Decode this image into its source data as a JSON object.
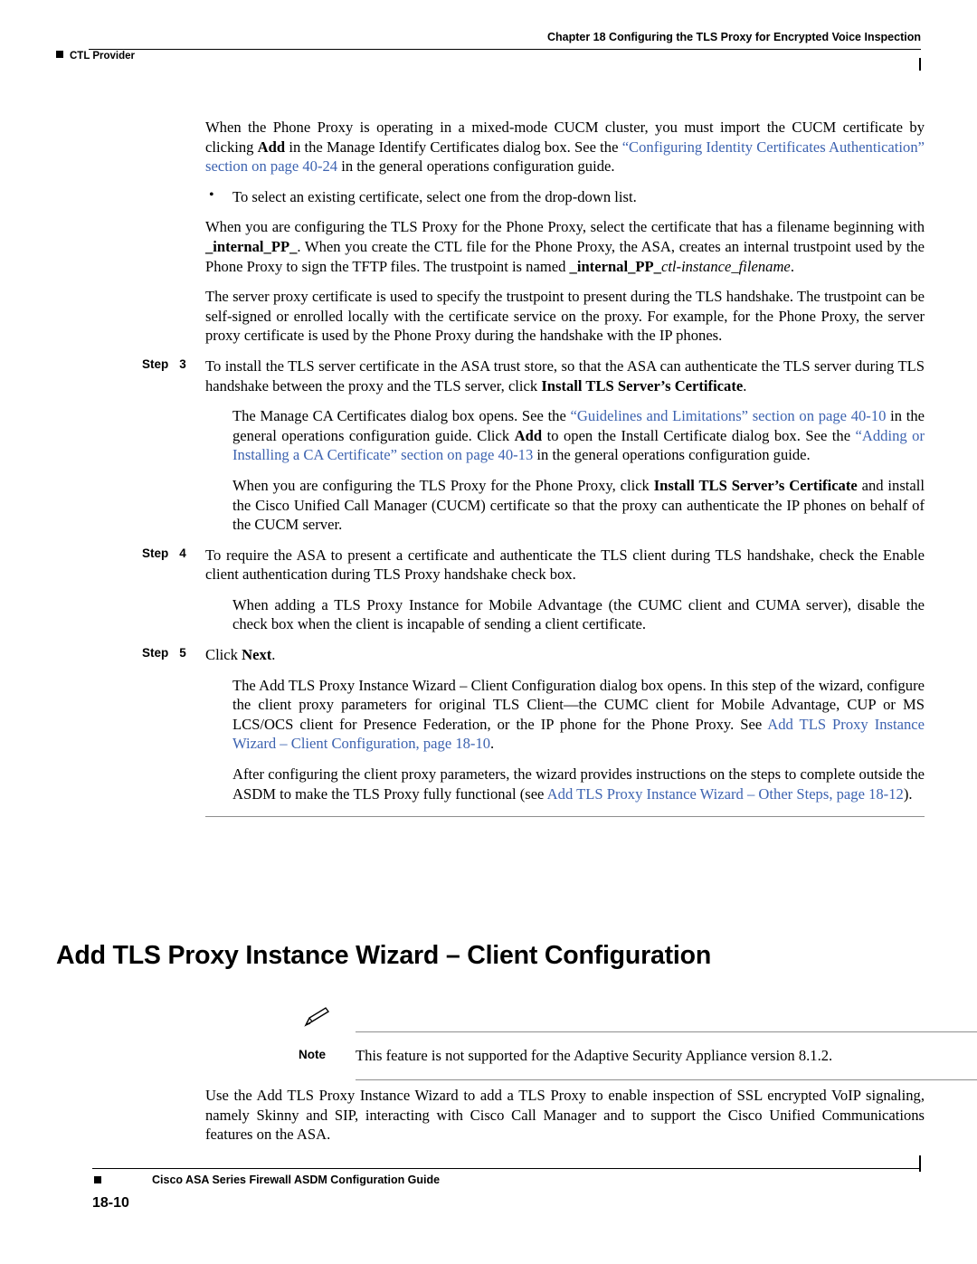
{
  "header": {
    "chapter": "Chapter 18      Configuring the TLS Proxy for Encrypted Voice Inspection",
    "left_label": "CTL Provider"
  },
  "body": {
    "p1_a": "When the Phone Proxy is operating in a mixed-mode CUCM cluster, you must import the CUCM certificate by clicking ",
    "p1_b": "Add",
    "p1_c": " in the Manage Identify Certificates dialog box. See the ",
    "p1_link1": "“Configuring Identity Certificates Authentication” section on page 40-24",
    "p1_d": " in the general operations configuration guide.",
    "bullet1": "To select an existing certificate, select one from the drop-down list.",
    "p2_a": "When you are configuring the TLS Proxy for the Phone Proxy, select the certificate that has a filename beginning with ",
    "p2_b": "_internal_PP_",
    "p2_c": ". When you create the CTL file for the Phone Proxy, the ASA, creates an internal trustpoint used by the Phone Proxy to sign the TFTP files. The trustpoint is named ",
    "p2_d": "_internal_PP_",
    "p2_e": "ctl-instance_filename",
    "p2_f": ".",
    "p3": "The server proxy certificate is used to specify the trustpoint to present during the TLS handshake. The trustpoint can be self-signed or enrolled locally with the certificate service on the proxy. For example, for the Phone Proxy, the server proxy certificate is used by the Phone Proxy during the handshake with the IP phones.",
    "step3_label": "Step",
    "step3_num": "3",
    "step3_a": "To install the TLS server certificate in the ASA trust store, so that the ASA can authenticate the TLS server during TLS handshake between the proxy and the TLS server, click ",
    "step3_b": "Install TLS Server’s Certificate",
    "step3_c": ".",
    "p4_a": "The Manage CA Certificates dialog box opens. See the ",
    "p4_link1": "“Guidelines and Limitations” section on page 40-10",
    "p4_b": " in the general operations configuration guide. Click ",
    "p4_bold": "Add",
    "p4_c": " to open the Install Certificate dialog box. See the ",
    "p4_link2": "“Adding or Installing a CA Certificate” section on page 40-13",
    "p4_d": " in the general operations configuration guide.",
    "p5_a": "When you are configuring the TLS Proxy for the Phone Proxy, click ",
    "p5_b": "Install TLS Server’s Certificate",
    "p5_c": " and install the Cisco Unified Call Manager (CUCM) certificate so that the proxy can authenticate the IP phones on behalf of the CUCM server.",
    "step4_label": "Step",
    "step4_num": "4",
    "step4_text": "To require the ASA to present a certificate and authenticate the TLS client during TLS handshake, check the Enable client authentication during TLS Proxy handshake check box.",
    "p6": "When adding a TLS Proxy Instance for Mobile Advantage (the CUMC client and CUMA server), disable the check box when the client is incapable of sending a client certificate.",
    "step5_label": "Step",
    "step5_num": "5",
    "step5_a": "Click ",
    "step5_b": "Next",
    "step5_c": ".",
    "p7_a": "The Add TLS Proxy Instance Wizard – Client Configuration dialog box opens. In this step of the wizard, configure the client proxy parameters for original TLS Client—the CUMC client for Mobile Advantage, CUP or MS LCS/OCS client for Presence Federation, or the IP phone for the Phone Proxy. See ",
    "p7_link": "Add TLS Proxy Instance Wizard – Client Configuration, page 18-10",
    "p7_b": ".",
    "p8_a": "After configuring the client proxy parameters, the wizard provides instructions on the steps to complete outside the ASDM to make the TLS Proxy fully functional (see ",
    "p8_link": "Add TLS Proxy Instance Wizard – Other Steps, page 18-12",
    "p8_b": ")."
  },
  "section": {
    "heading": "Add TLS Proxy Instance Wizard – Client Configuration"
  },
  "note": {
    "label": "Note",
    "text": "This feature is not supported for the Adaptive Security Appliance version 8.1.2."
  },
  "closing": {
    "text": "Use the Add TLS Proxy Instance Wizard to add a TLS Proxy to enable inspection of SSL encrypted VoIP signaling, namely Skinny and SIP, interacting with Cisco Call Manager and to support the Cisco Unified Communications features on the ASA."
  },
  "footer": {
    "title": "Cisco ASA Series Firewall ASDM Configuration Guide",
    "page": "18-10"
  }
}
